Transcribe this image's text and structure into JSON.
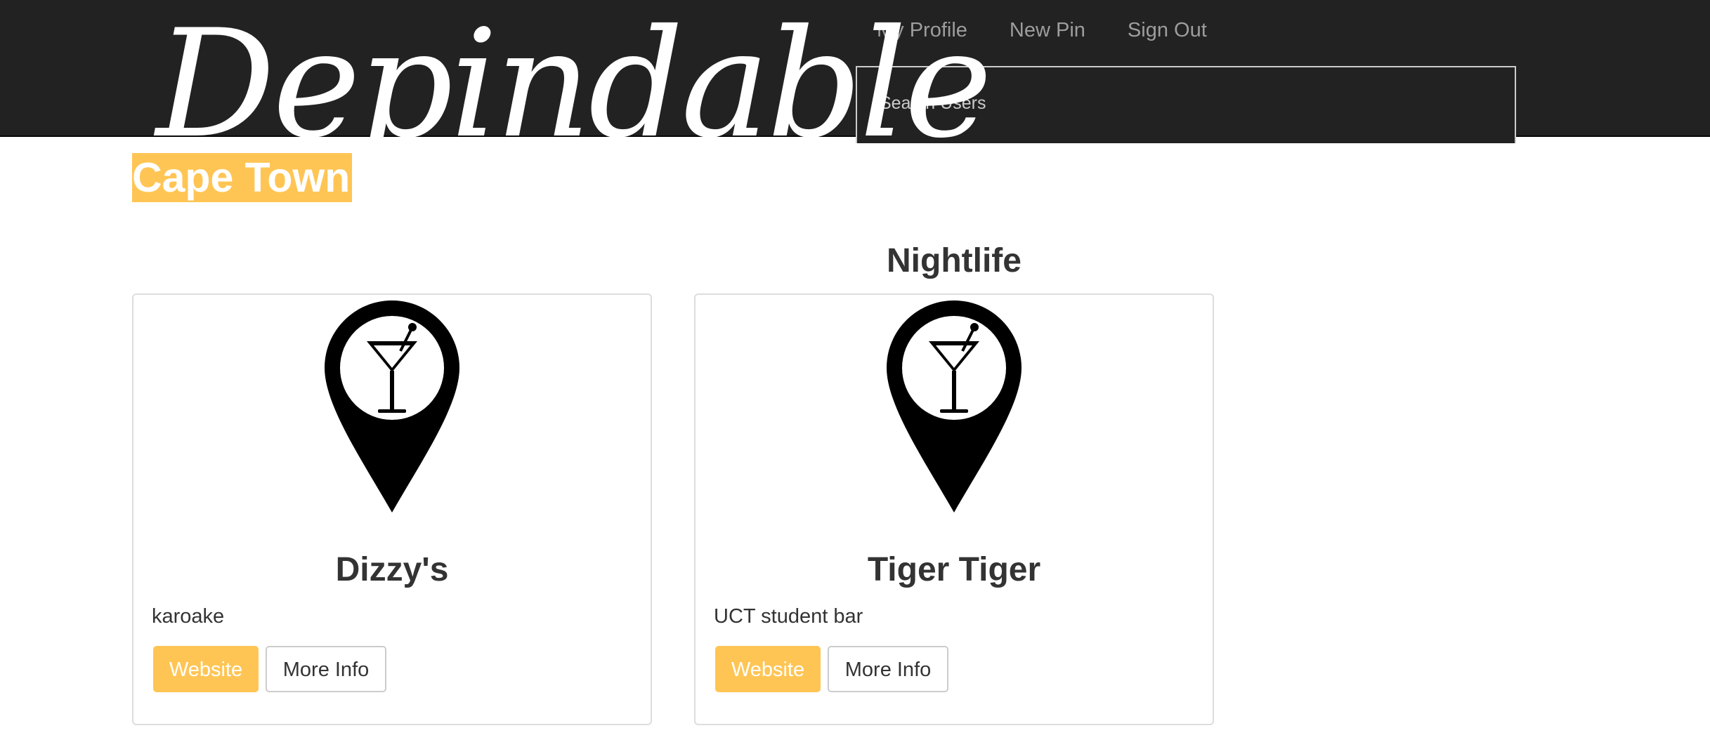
{
  "app": {
    "brand": "Depindable"
  },
  "nav": {
    "links": [
      "My Profile",
      "New Pin",
      "Sign Out"
    ]
  },
  "search": {
    "placeholder": "Search Users",
    "value": ""
  },
  "page": {
    "city": "Cape Town",
    "section_title": "Nightlife"
  },
  "cards": [
    {
      "icon": "cocktail-pin-icon",
      "name": "Dizzy's",
      "description": "karoake",
      "website_label": "Website",
      "info_label": "More Info"
    },
    {
      "icon": "cocktail-pin-icon",
      "name": "Tiger Tiger",
      "description": "UCT student bar",
      "website_label": "Website",
      "info_label": "More Info"
    }
  ],
  "colors": {
    "navbar": "#222222",
    "accent": "#ffc554",
    "text": "#333333",
    "nav_link": "#9d9d9d"
  }
}
